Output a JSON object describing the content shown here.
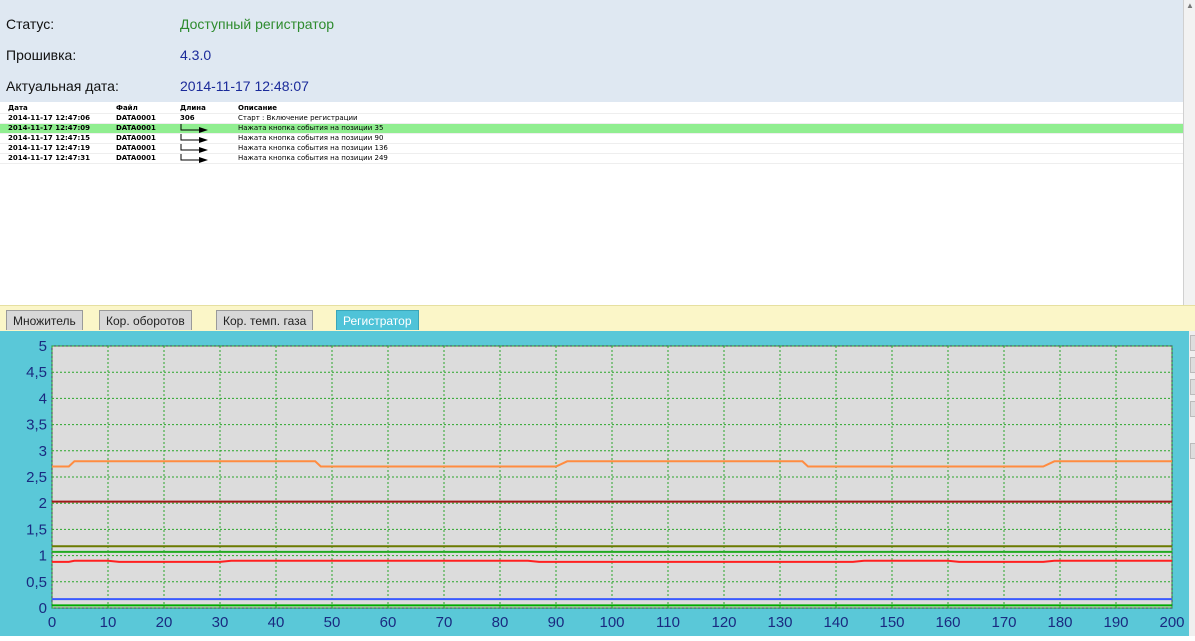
{
  "info": {
    "status_label": "Статус:",
    "status_value": "Доступный регистратор",
    "firmware_label": "Прошивка:",
    "firmware_value": "4.3.0",
    "date_label": "Актуальная дата:",
    "date_value": "2014-11-17 12:48:07",
    "colors": {
      "status": "#2e8b2e",
      "value": "#1a2a9a"
    }
  },
  "log": {
    "headers": {
      "date": "Дата",
      "file": "Файл",
      "length": "Длина",
      "description": "Описание"
    },
    "rows": [
      {
        "date": "2014-11-17 12:47:06",
        "file": "DATA0001",
        "length": "306",
        "description": "Старт : Включение регистрации",
        "arrow": false,
        "highlight": false
      },
      {
        "date": "2014-11-17 12:47:09",
        "file": "DATA0001",
        "length": "",
        "description": "Нажата кнопка события на позиции 35",
        "arrow": true,
        "highlight": true
      },
      {
        "date": "2014-11-17 12:47:15",
        "file": "DATA0001",
        "length": "",
        "description": "Нажата кнопка события на позиции 90",
        "arrow": true,
        "highlight": false
      },
      {
        "date": "2014-11-17 12:47:19",
        "file": "DATA0001",
        "length": "",
        "description": "Нажата кнопка события на позиции 136",
        "arrow": true,
        "highlight": false
      },
      {
        "date": "2014-11-17 12:47:31",
        "file": "DATA0001",
        "length": "",
        "description": "Нажата кнопка события на позиции 249",
        "arrow": true,
        "highlight": false
      }
    ]
  },
  "tabs": [
    {
      "label": "Множитель",
      "active": false
    },
    {
      "label": "Кор. оборотов",
      "active": false
    },
    {
      "label": "Кор. темп. газа",
      "active": false
    },
    {
      "label": "Регистратор",
      "active": true
    }
  ],
  "chart_data": {
    "type": "line",
    "xlim": [
      0,
      200
    ],
    "ylim": [
      0,
      5
    ],
    "x_ticks": [
      0,
      10,
      20,
      30,
      40,
      50,
      60,
      70,
      80,
      90,
      100,
      110,
      120,
      130,
      140,
      150,
      160,
      170,
      180,
      190,
      200
    ],
    "y_ticks": [
      0,
      0.5,
      1,
      1.5,
      2,
      2.5,
      3,
      3.5,
      4,
      4.5,
      5
    ],
    "y_tick_labels": [
      "0",
      "0,5",
      "1",
      "1,5",
      "2",
      "2,5",
      "3",
      "3,5",
      "4",
      "4,5",
      "5"
    ],
    "grid": true,
    "background": "#dcdcdc",
    "series": [
      {
        "color": "#ff8c40",
        "x": [
          0,
          3,
          4,
          47,
          48,
          90,
          92,
          134,
          135,
          177,
          179,
          200
        ],
        "y": [
          2.7,
          2.7,
          2.8,
          2.8,
          2.7,
          2.7,
          2.8,
          2.8,
          2.7,
          2.7,
          2.8,
          2.8
        ]
      },
      {
        "color": "#a01818",
        "x": [
          0,
          200
        ],
        "y": [
          2.03,
          2.03
        ]
      },
      {
        "color": "#6b7a00",
        "x": [
          0,
          200
        ],
        "y": [
          1.18,
          1.18
        ]
      },
      {
        "color": "#22aa22",
        "x": [
          0,
          200
        ],
        "y": [
          1.07,
          1.07
        ]
      },
      {
        "color": "#ff2020",
        "x": [
          0,
          3,
          4,
          10,
          12,
          30,
          32,
          85,
          87,
          143,
          145,
          160,
          162,
          177,
          179,
          200
        ],
        "y": [
          0.88,
          0.88,
          0.9,
          0.9,
          0.88,
          0.88,
          0.9,
          0.9,
          0.88,
          0.88,
          0.9,
          0.9,
          0.88,
          0.88,
          0.9,
          0.9
        ]
      },
      {
        "color": "#3a5aff",
        "x": [
          0,
          200
        ],
        "y": [
          0.17,
          0.17
        ]
      },
      {
        "color": "#00aa00",
        "x": [
          0,
          200
        ],
        "y": [
          0.05,
          0.05
        ]
      }
    ]
  }
}
